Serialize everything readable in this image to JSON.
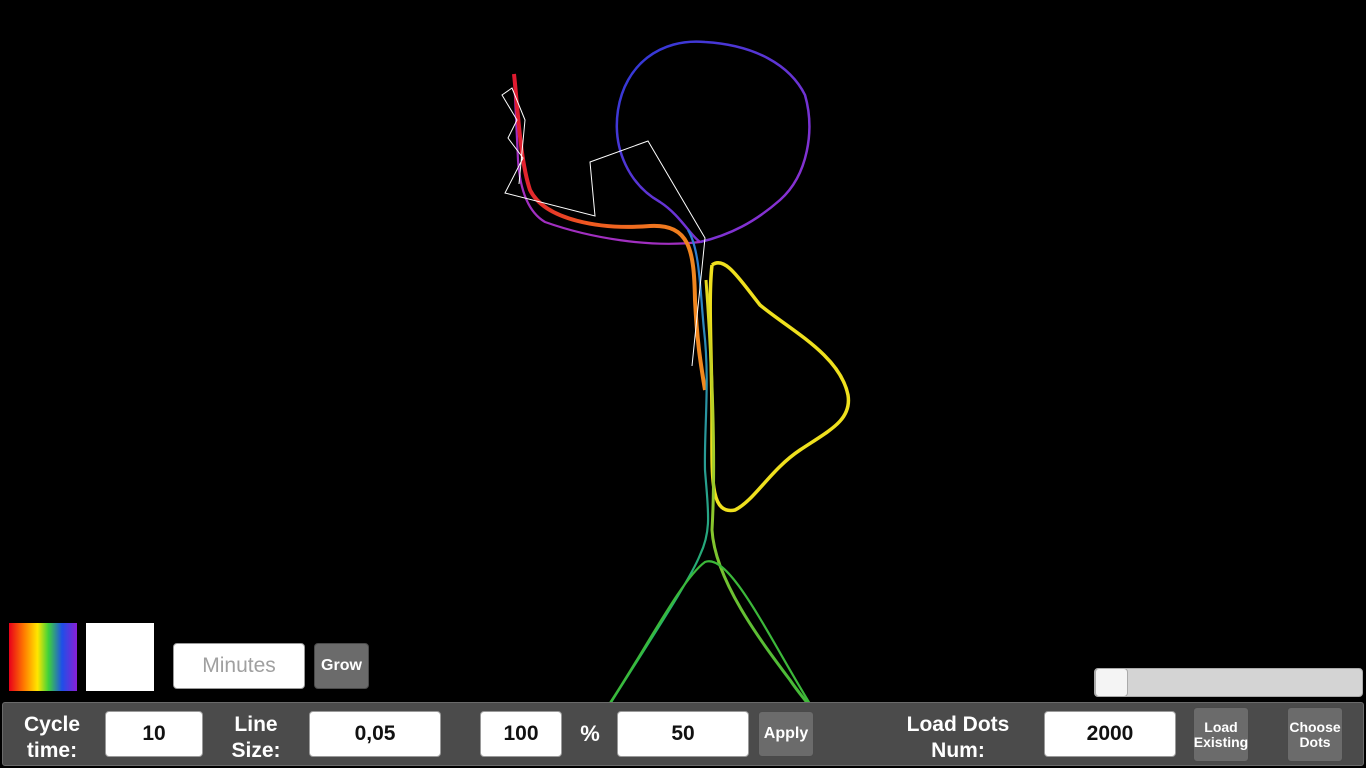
{
  "swatches": [
    {
      "name": "rainbow",
      "type": "gradient"
    },
    {
      "name": "white",
      "color": "#ffffff"
    }
  ],
  "minutes": {
    "value": "",
    "placeholder": "Minutes"
  },
  "grow_label": "Grow",
  "slider": {
    "value_fraction": 0.0
  },
  "bottom_bar": {
    "cycle_time_label": "Cycle time:",
    "cycle_time_value": "10",
    "line_size_label": "Line Size:",
    "line_size_value": "0,05",
    "percent_value": "100",
    "percent_sign": "%",
    "second_value": "50",
    "apply_label": "Apply",
    "load_dots_label": "Load Dots Num:",
    "load_dots_value": "2000",
    "load_existing_label": "Load Existing",
    "choose_dots_label": "Choose Dots"
  },
  "colors": {
    "background": "#000000",
    "bar": "#4b4b4b",
    "button": "#6b6b6b",
    "stroke_red": "#e01a2e",
    "stroke_orange": "#f07a22",
    "stroke_yellow": "#f2e21c",
    "stroke_green": "#3cb83a",
    "stroke_blue": "#2c4fdc",
    "stroke_purple": "#8a2fd0",
    "stroke_white": "#ffffff"
  }
}
